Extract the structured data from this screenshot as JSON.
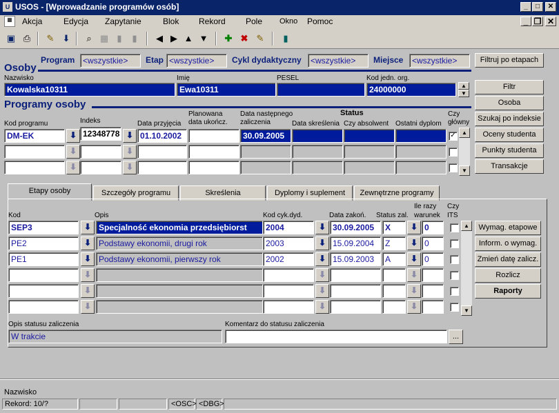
{
  "window": {
    "title": "USOS - [Wprowadzanie programów osób]"
  },
  "menu": {
    "items": [
      "Akcja",
      "Edycja",
      "Zapytanie",
      "Blok",
      "Rekord",
      "Pole",
      "Okno",
      "Pomoc"
    ]
  },
  "filter": {
    "program_label": "Program",
    "program_value": "<wszystkie>",
    "etap_label": "Etap",
    "etap_value": "<wszystkie>",
    "cykl_label": "Cykl dydaktyczny",
    "cykl_value": "<wszystkie>",
    "miejsce_label": "Miejsce",
    "miejsce_value": "<wszystkie>",
    "filter_button": "Filtruj po etapach"
  },
  "osoby": {
    "section_title": "Osoby",
    "nazwisko_label": "Nazwisko",
    "nazwisko": "Kowalska10311",
    "imie_label": "Imię",
    "imie": "Ewa10311",
    "pesel_label": "PESEL",
    "pesel": "",
    "kod_label": "Kod jedn. org.",
    "kod": "24000000"
  },
  "side_buttons": [
    "Filtr",
    "Osoba",
    "Szukaj po indeksie",
    "Oceny studenta",
    "Punkty studenta",
    "Transakcje"
  ],
  "programy": {
    "section_title": "Programy osoby",
    "col_kod": "Kod programu",
    "col_indeks": "Indeks",
    "col_data_przyjecia": "Data przyjęcia",
    "col_planowana": "Planowana data ukończ.",
    "col_nastepnego": "Data następnego zaliczenia",
    "status_title": "Status",
    "col_skreslenia": "Data skreślenia",
    "col_absolwent": "Czy absolwent",
    "col_dyplom": "Ostatni dyplom",
    "col_glowny": "Czy główny",
    "row_kod": "DM-EK",
    "row_indeks": "12348778",
    "row_przyjecia": "01.10.2002",
    "row_planowana": "",
    "row_nastepnego": "30.09.2005",
    "row_glowny": "✓"
  },
  "tabs": [
    "Etapy osoby",
    "Szczegóły programu",
    "Skreślenia",
    "Dyplomy i suplement",
    "Zewnętrzne programy"
  ],
  "etapy": {
    "col_kod": "Kod",
    "col_opis": "Opis",
    "col_cykl": "Kod cyk.dyd.",
    "col_data": "Data zakoń.",
    "col_status": "Status zal.",
    "col_ile": "Ile razy warunek",
    "col_its": "Czy ITS",
    "rows": [
      {
        "kod": "SEP3",
        "opis": "Specjalność ekonomia przedsiębiorst",
        "cykl": "2004",
        "data": "30.09.2005",
        "status": "X",
        "ile": "0"
      },
      {
        "kod": "PE2",
        "opis": "Podstawy ekonomii, drugi rok",
        "cykl": "2003",
        "data": "15.09.2004",
        "status": "Z",
        "ile": "0"
      },
      {
        "kod": "PE1",
        "opis": "Podstawy ekonomii, pierwszy rok",
        "cykl": "2002",
        "data": "15.09.2003",
        "status": "A",
        "ile": "0"
      }
    ],
    "buttons": [
      "Wymag. etapowe",
      "Inform. o wymag.",
      "Zmień datę zalicz.",
      "Rozlicz",
      "Raporty"
    ],
    "opis_statusu_label": "Opis statusu zaliczenia",
    "opis_statusu": "W trakcie",
    "komentarz_label": "Komentarz do statusu zaliczenia",
    "komentarz": "",
    "more_button": "..."
  },
  "statusbar": {
    "field_name": "Nazwisko",
    "rekord": "Rekord: 10/?",
    "osc": "<OSC>",
    "dbg": "<DBG>"
  }
}
